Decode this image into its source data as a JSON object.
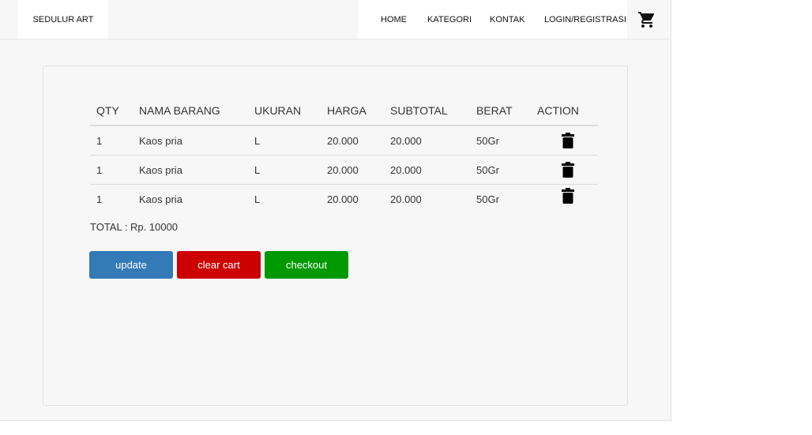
{
  "brand": "SEDULUR ART",
  "nav": {
    "home": "HOME",
    "kategori": "KATEGORI",
    "kontak": "KONTAK",
    "login": "LOGIN/REGISTRASI"
  },
  "icons": {
    "cart": "shopping-cart-icon",
    "delete": "trash-icon"
  },
  "table": {
    "headers": [
      "QTY",
      "NAMA BARANG",
      "UKURAN",
      "HARGA",
      "SUBTOTAL",
      "BERAT",
      "ACTION"
    ],
    "rows": [
      {
        "qty": "1",
        "name": "Kaos pria",
        "size": "L",
        "price": "20.000",
        "subtotal": "20.000",
        "weight": "50Gr"
      },
      {
        "qty": "1",
        "name": "Kaos pria",
        "size": "L",
        "price": "20.000",
        "subtotal": "20.000",
        "weight": "50Gr"
      },
      {
        "qty": "1",
        "name": "Kaos pria",
        "size": "L",
        "price": "20.000",
        "subtotal": "20.000",
        "weight": "50Gr"
      }
    ]
  },
  "total": "TOTAL : Rp. 10000",
  "buttons": {
    "update": "update",
    "clear": "clear cart",
    "checkout": "checkout"
  },
  "colors": {
    "update": "#337ab7",
    "clear": "#cc0000",
    "checkout": "#009900"
  }
}
